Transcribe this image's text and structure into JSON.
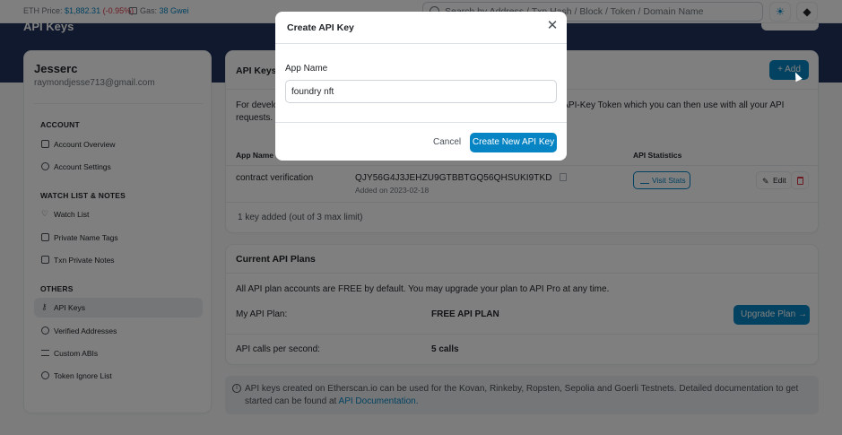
{
  "topbar": {
    "eth_price_label": "ETH Price:",
    "eth_price_value": "$1,882.31",
    "eth_price_change": "(-0.95%)",
    "gas_label": "Gas:",
    "gas_value": "38 Gwei",
    "search_placeholder": "Search by Address / Txn Hash / Block / Token / Domain Name",
    "theme_icon": "sun-icon",
    "network_icon": "ethereum-icon"
  },
  "header": {
    "page_title": "API Keys"
  },
  "sidebar": {
    "username": "Jesserc",
    "email": "raymondjesse713@gmail.com",
    "sections": [
      {
        "title": "ACCOUNT",
        "items": [
          {
            "label": "Account Overview",
            "icon": "home-icon"
          },
          {
            "label": "Account Settings",
            "icon": "user-gear-icon"
          }
        ]
      },
      {
        "title": "WATCH LIST & NOTES",
        "items": [
          {
            "label": "Watch List",
            "icon": "heart-icon"
          },
          {
            "label": "Private Name Tags",
            "icon": "tag-icon"
          },
          {
            "label": "Txn Private Notes",
            "icon": "note-icon"
          }
        ]
      },
      {
        "title": "OTHERS",
        "items": [
          {
            "label": "API Keys",
            "icon": "key-icon",
            "active": true
          },
          {
            "label": "Verified Addresses",
            "icon": "check-circle-icon"
          },
          {
            "label": "Custom ABIs",
            "icon": "list-icon"
          },
          {
            "label": "Token Ignore List",
            "icon": "eye-slash-icon"
          }
        ]
      }
    ]
  },
  "api_keys_card": {
    "title": "API Keys",
    "add_button": "Add",
    "description_start": "For develo",
    "description_end": "API-Key Token which you can then use with all your API requests.",
    "columns": {
      "app_name": "App Name",
      "api_statistics": "API Statistics"
    },
    "rows": [
      {
        "app_name": "contract verification",
        "api_key": "QJY56G4J3JEHZU9GTBBTGQ56QHSUKI9TKD",
        "added": "Added on 2023-02-18",
        "visit_stats": "Visit Stats",
        "edit": "Edit"
      }
    ],
    "footer": "1 key added (out of 3 max limit)"
  },
  "plans_card": {
    "title": "Current API Plans",
    "note": "All API plan accounts are FREE by default. You may upgrade your plan to API Pro at any time.",
    "my_plan_label": "My API Plan:",
    "my_plan_value": "FREE API PLAN",
    "upgrade_button": "Upgrade Plan",
    "calls_label": "API calls per second:",
    "calls_value": "5 calls"
  },
  "alert": {
    "text": "API keys created on Etherscan.io can be used for the Kovan, Rinkeby, Ropsten, Sepolia and Goerli Testnets. Detailed documentation to get started can be found at",
    "link": "API Documentation."
  },
  "modal": {
    "title": "Create API Key",
    "field_label": "App Name",
    "field_value": "foundry nft",
    "cancel_button": "Cancel",
    "create_button": "Create New API Key"
  },
  "colors": {
    "primary": "#0784c3",
    "header_bg": "#21325b",
    "danger": "#dc3545"
  }
}
